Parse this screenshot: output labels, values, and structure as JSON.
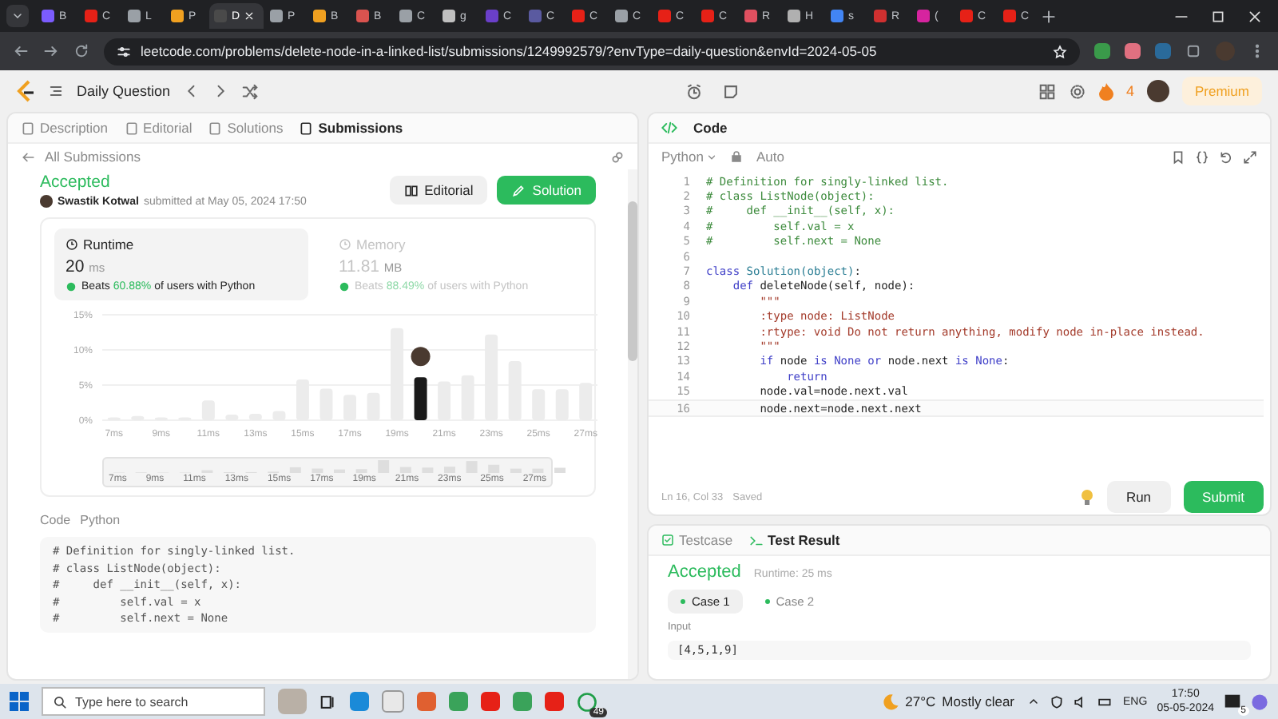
{
  "browser": {
    "tabs": [
      {
        "label": "B",
        "color": "#7b5cff",
        "selected": false
      },
      {
        "label": "C",
        "color": "#e62117",
        "selected": false
      },
      {
        "label": "L",
        "color": "#9aa0a6",
        "selected": false
      },
      {
        "label": "P",
        "color": "#f0a020",
        "selected": false
      },
      {
        "label": "D",
        "color": "#4a4a4a",
        "selected": true
      },
      {
        "label": "P",
        "color": "#9aa0a6",
        "selected": false
      },
      {
        "label": "B",
        "color": "#f0a020",
        "selected": false
      },
      {
        "label": "B",
        "color": "#d9534f",
        "selected": false
      },
      {
        "label": "C",
        "color": "#9aa0a6",
        "selected": false
      },
      {
        "label": "g",
        "color": "#c0c0c0",
        "selected": false
      },
      {
        "label": "C",
        "color": "#6a3fc9",
        "selected": false
      },
      {
        "label": "C",
        "color": "#5a5aa0",
        "selected": false
      },
      {
        "label": "C",
        "color": "#e62117",
        "selected": false
      },
      {
        "label": "C",
        "color": "#9aa0a6",
        "selected": false
      },
      {
        "label": "C",
        "color": "#e62117",
        "selected": false
      },
      {
        "label": "C",
        "color": "#e62117",
        "selected": false
      },
      {
        "label": "R",
        "color": "#e05060",
        "selected": false
      },
      {
        "label": "H",
        "color": "#b0b0b0",
        "selected": false
      },
      {
        "label": "s",
        "color": "#4285f4",
        "selected": false
      },
      {
        "label": "R",
        "color": "#d03030",
        "selected": false
      },
      {
        "label": "(",
        "color": "#d6249f",
        "selected": false
      },
      {
        "label": "C",
        "color": "#e62117",
        "selected": false
      },
      {
        "label": "C",
        "color": "#e62117",
        "selected": false
      }
    ],
    "url": "leetcode.com/problems/delete-node-in-a-linked-list/submissions/1249992579/?envType=daily-question&envId=2024-05-05"
  },
  "nav": {
    "title": "Daily Question",
    "streak": "4",
    "premium": "Premium"
  },
  "left_panel": {
    "tabs": [
      {
        "label": "Description",
        "selected": false
      },
      {
        "label": "Editorial",
        "selected": false
      },
      {
        "label": "Solutions",
        "selected": false
      },
      {
        "label": "Submissions",
        "selected": true
      }
    ],
    "back_link": "All Submissions",
    "submission": {
      "status": "Accepted",
      "author": "Swastik Kotwal",
      "submitted": "submitted at May 05, 2024 17:50"
    },
    "buttons": [
      {
        "label": "Editorial",
        "kind": "secondary"
      },
      {
        "label": "Solution",
        "kind": "primary"
      }
    ],
    "stats": [
      {
        "title": "Runtime",
        "value": "20",
        "unit": "ms",
        "beats": "Beats",
        "percent": "60.88%",
        "suffix": "of users with Python",
        "selected": true
      },
      {
        "title": "Memory",
        "value": "11.81",
        "unit": "MB",
        "beats": "Beats",
        "percent": "88.49%",
        "suffix": "of users with Python",
        "selected": false
      }
    ],
    "chart_data": {
      "type": "bar",
      "x": [
        7,
        8,
        9,
        10,
        11,
        12,
        13,
        14,
        15,
        16,
        17,
        18,
        19,
        20,
        21,
        22,
        23,
        24,
        25,
        26,
        27
      ],
      "xlim": [
        6.5,
        27.5
      ],
      "series": [
        {
          "color": "#ececec",
          "values": [
            0.4,
            0.6,
            0.4,
            0.4,
            2.8,
            0.8,
            0.9,
            1.3,
            5.8,
            4.5,
            3.6,
            3.9,
            13.1,
            null,
            5.5,
            6.4,
            12.2,
            8.4,
            4.4,
            4.4,
            5.3
          ]
        },
        {
          "color": "#1a1a1a",
          "values": [
            null,
            null,
            null,
            null,
            null,
            null,
            null,
            null,
            null,
            null,
            null,
            null,
            null,
            6.1,
            null,
            null,
            null,
            null,
            null,
            null,
            null
          ]
        }
      ],
      "ylim": [
        0,
        15
      ],
      "yticks": [
        {
          "value": 0,
          "label": "0%"
        },
        {
          "value": 5,
          "label": "5%"
        },
        {
          "value": 10,
          "label": "10%"
        },
        {
          "value": 15,
          "label": "15%"
        }
      ],
      "xticks": [
        {
          "value": 7,
          "label": "7ms"
        },
        {
          "value": 9,
          "label": "9ms"
        },
        {
          "value": 11,
          "label": "11ms"
        },
        {
          "value": 13,
          "label": "13ms"
        },
        {
          "value": 15,
          "label": "15ms"
        },
        {
          "value": 17,
          "label": "17ms"
        },
        {
          "value": 19,
          "label": "19ms"
        },
        {
          "value": 21,
          "label": "21ms"
        },
        {
          "value": 23,
          "label": "23ms"
        },
        {
          "value": 25,
          "label": "25ms"
        },
        {
          "value": 27,
          "label": "27ms"
        }
      ]
    },
    "range": {
      "level": 1,
      "labels": [
        "7ms",
        "9ms",
        "11ms",
        "13ms",
        "15ms",
        "17ms",
        "19ms",
        "21ms",
        "23ms",
        "25ms",
        "27ms"
      ]
    },
    "code_label": "Code",
    "code_language": "Python",
    "code_lines": [
      "# Definition for singly-linked list.",
      "# class ListNode(object):",
      "#     def __init__(self, x):",
      "#         self.val = x",
      "#         self.next = None"
    ]
  },
  "editor": {
    "title": "Code",
    "language": "Python",
    "mode": "Auto",
    "lines": [
      {
        "number": "1",
        "segments": [
          {
            "text": "# Definition for singly-linked list.",
            "kind": "comment"
          }
        ]
      },
      {
        "number": "2",
        "segments": [
          {
            "text": "# class ListNode(object):",
            "kind": "comment"
          }
        ]
      },
      {
        "number": "3",
        "segments": [
          {
            "text": "#     def __init__(self, x):",
            "kind": "comment"
          }
        ]
      },
      {
        "number": "4",
        "segments": [
          {
            "text": "#         self.val = x",
            "kind": "comment"
          }
        ]
      },
      {
        "number": "5",
        "segments": [
          {
            "text": "#         self.next = None",
            "kind": "comment"
          }
        ]
      },
      {
        "number": "6"
      },
      {
        "number": "7",
        "segments": [
          {
            "text": "class ",
            "kind": "keyword"
          },
          {
            "text": "Solution(object)",
            "kind": "type"
          },
          {
            "text": ":",
            "kind": "plain"
          }
        ]
      },
      {
        "number": "8",
        "segments": [
          {
            "text": "    def ",
            "kind": "keyword"
          },
          {
            "text": "deleteNode(self, node):",
            "kind": "plain"
          }
        ]
      },
      {
        "number": "9",
        "segments": [
          {
            "text": "        \"\"\"",
            "kind": "string"
          }
        ]
      },
      {
        "number": "10",
        "segments": [
          {
            "text": "        :type node: ListNode",
            "kind": "string"
          }
        ]
      },
      {
        "number": "11",
        "segments": [
          {
            "text": "        :rtype: void Do not return anything, modify node in-place instead.",
            "kind": "string"
          }
        ]
      },
      {
        "number": "12",
        "segments": [
          {
            "text": "        \"\"\"",
            "kind": "string"
          }
        ]
      },
      {
        "number": "13",
        "segments": [
          {
            "text": "        if",
            "kind": "keyword"
          },
          {
            "text": " node ",
            "kind": "plain"
          },
          {
            "text": "is None or",
            "kind": "keyword"
          },
          {
            "text": " node.next ",
            "kind": "plain"
          },
          {
            "text": "is None",
            "kind": "keyword"
          },
          {
            "text": ":",
            "kind": "plain"
          }
        ]
      },
      {
        "number": "14",
        "segments": [
          {
            "text": "            return",
            "kind": "keyword"
          }
        ]
      },
      {
        "number": "15",
        "segments": [
          {
            "text": "        node.val=node.next.val",
            "kind": "plain"
          }
        ]
      },
      {
        "number": "16",
        "segments": [
          {
            "text": "        node.next=node.next.next",
            "kind": "plain"
          }
        ]
      }
    ],
    "position": "Ln 16, Col 33",
    "save_state": "Saved",
    "buttons": [
      {
        "label": "Run",
        "kind": "secondary"
      },
      {
        "label": "Submit",
        "kind": "primary"
      }
    ]
  },
  "console": {
    "tabs": [
      {
        "label": "Testcase",
        "selected": false
      },
      {
        "label": "Test Result",
        "selected": true
      }
    ],
    "status": "Accepted",
    "runtime": "Runtime: 25 ms",
    "cases": [
      {
        "label": "Case 1",
        "selected": true
      },
      {
        "label": "Case 2",
        "selected": false
      }
    ],
    "input_label": "Input",
    "input_value": "[4,5,1,9]"
  },
  "taskbar": {
    "search_placeholder": "Type here to search",
    "whatsapp_badge": "49",
    "temperature": "27°C",
    "weather": "Mostly clear",
    "language": "ENG",
    "time": "17:50",
    "date": "05-05-2024",
    "notifications": "5"
  }
}
